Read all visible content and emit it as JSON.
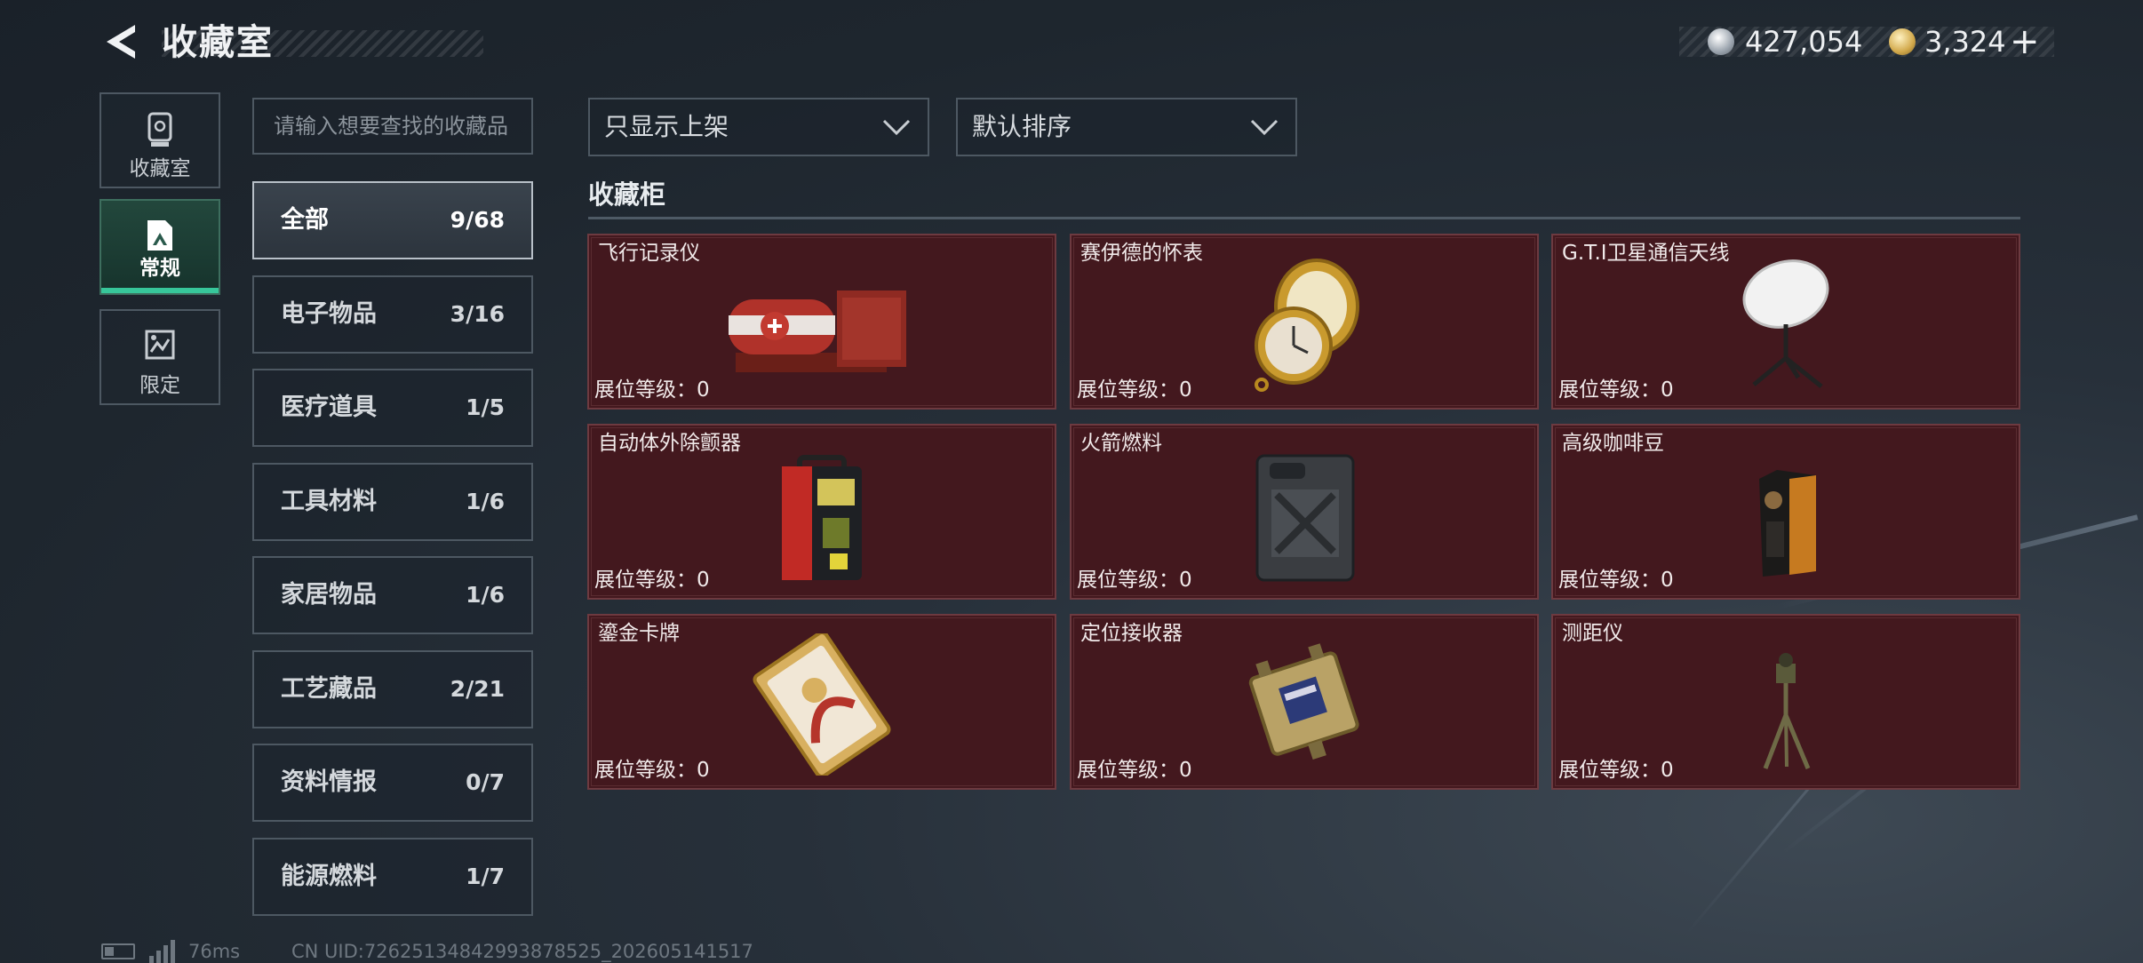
{
  "header": {
    "title": "收藏室",
    "currency_silver": "427,054",
    "currency_gold": "3,324",
    "plus_label": "+"
  },
  "left_nav": [
    {
      "label": "收藏室",
      "icon": "trophy-icon"
    },
    {
      "label": "常规",
      "icon": "image-card-icon"
    },
    {
      "label": "限定",
      "icon": "limited-card-icon"
    }
  ],
  "search": {
    "placeholder": "请输入想要查找的收藏品"
  },
  "categories": [
    {
      "name": "全部",
      "count": "9/68"
    },
    {
      "name": "电子物品",
      "count": "3/16"
    },
    {
      "name": "医疗道具",
      "count": "1/5"
    },
    {
      "name": "工具材料",
      "count": "1/6"
    },
    {
      "name": "家居物品",
      "count": "1/6"
    },
    {
      "name": "工艺藏品",
      "count": "2/21"
    },
    {
      "name": "资料情报",
      "count": "0/7"
    },
    {
      "name": "能源燃料",
      "count": "1/7"
    }
  ],
  "filters": {
    "filter_value": "只显示上架",
    "sort_value": "默认排序"
  },
  "section_title": "收藏柜",
  "items": [
    {
      "name": "飞行记录仪",
      "level": "展位等级：0",
      "icon": "flight-recorder-icon"
    },
    {
      "name": "赛伊德的怀表",
      "level": "展位等级：0",
      "icon": "pocket-watch-icon"
    },
    {
      "name": "G.T.I卫星通信天线",
      "level": "展位等级：0",
      "icon": "satellite-dish-icon"
    },
    {
      "name": "自动体外除颤器",
      "level": "展位等级：0",
      "icon": "defibrillator-icon"
    },
    {
      "name": "火箭燃料",
      "level": "展位等级：0",
      "icon": "fuel-can-icon"
    },
    {
      "name": "高级咖啡豆",
      "level": "展位等级：0",
      "icon": "coffee-bag-icon"
    },
    {
      "name": "鎏金卡牌",
      "level": "展位等级：0",
      "icon": "gold-card-icon"
    },
    {
      "name": "定位接收器",
      "level": "展位等级：0",
      "icon": "gps-receiver-icon"
    },
    {
      "name": "测距仪",
      "level": "展位等级：0",
      "icon": "rangefinder-tripod-icon"
    }
  ],
  "status": {
    "ping": "76ms",
    "uid": "CN UID:7262513484299387852​5_202605141517"
  }
}
